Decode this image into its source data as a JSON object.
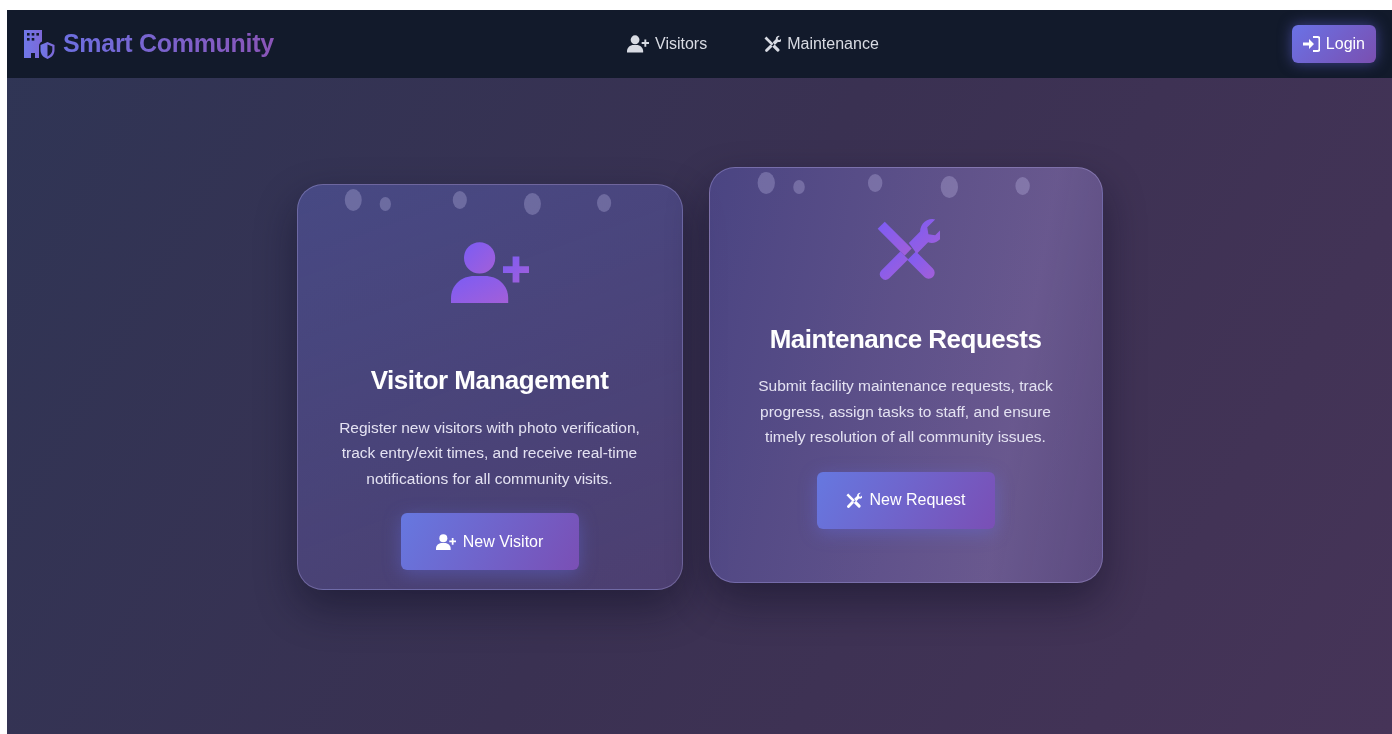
{
  "brand": {
    "name": "Smart Community"
  },
  "nav_links": [
    {
      "kind": "visitors",
      "label": "Visitors"
    },
    {
      "kind": "maintenance",
      "label": "Maintenance"
    }
  ],
  "login_button": {
    "label": "Login"
  },
  "cards": [
    {
      "kind": "visitors",
      "title": "Visitor Management",
      "description": "Register new visitors with photo verification, track entry/exit times, and receive real-time notifications for all community visits.",
      "button": "New Visitor",
      "hovered": false
    },
    {
      "kind": "maintenance",
      "title": "Maintenance Requests",
      "description": "Submit facility maintenance requests, track progress, assign tasks to staff, and ensure timely resolution of all community issues.",
      "button": "New Request",
      "hovered": true
    }
  ]
}
